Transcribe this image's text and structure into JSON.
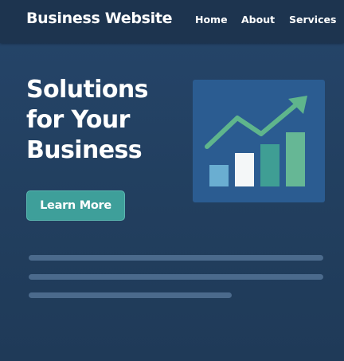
{
  "header": {
    "brand": "Business Website",
    "nav": [
      "Home",
      "About",
      "Services"
    ]
  },
  "hero": {
    "title_lines": [
      "Solutions",
      "for Your",
      "Business"
    ],
    "cta_label": "Learn More"
  },
  "illustration": {
    "type": "growth-chart-icon",
    "bar_levels": [
      0.38,
      0.58,
      0.74,
      0.95
    ],
    "bar_colors": [
      "#6aaed1",
      "#f4f7f8",
      "#3f9e94",
      "#66b795"
    ],
    "arrow_color": "#5fb58c"
  },
  "colors": {
    "background": "#213d5b",
    "header": "#1d344f",
    "accent": "#3e9f9a",
    "card": "#2b5c91"
  }
}
